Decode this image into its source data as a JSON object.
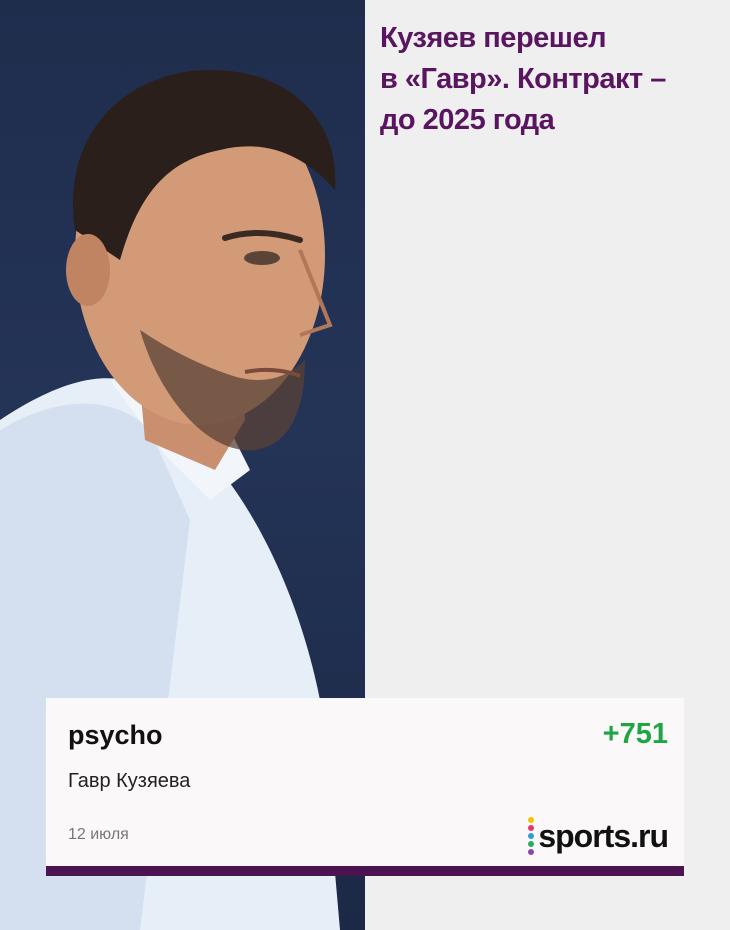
{
  "headline": {
    "lines": [
      "Кузяев перешел",
      "в «Гавр». Контракт –",
      "до 2025 года"
    ]
  },
  "card": {
    "username": "psycho",
    "rating": "+751",
    "comment": "Гавр Кузяева",
    "date": "12 июля"
  },
  "brand": {
    "logo_text": "sports.ru",
    "dot_colors": [
      "#f2c300",
      "#e8336d",
      "#2d9cdb",
      "#27ae60",
      "#8e44ad"
    ]
  },
  "colors": {
    "headline": "#5a1560",
    "rating": "#1ea645",
    "card_border": "#4b1450",
    "background": "#efefef"
  },
  "photo": {
    "icon": "player-portrait"
  }
}
